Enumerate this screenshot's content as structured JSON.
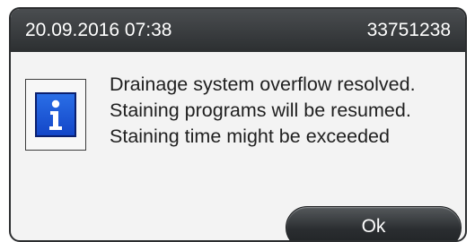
{
  "dialog": {
    "timestamp": "20.09.2016 07:38",
    "id": "33751238",
    "icon": "info-icon",
    "message_lines": [
      "Drainage system overflow resolved.",
      "Staining programs will be resumed.",
      "Staining time might be exceeded"
    ],
    "ok_label": "Ok"
  },
  "colors": {
    "title_bar": "#3a3d40",
    "info_blue": "#1a56d6",
    "dialog_bg": "#f3f3f3"
  }
}
